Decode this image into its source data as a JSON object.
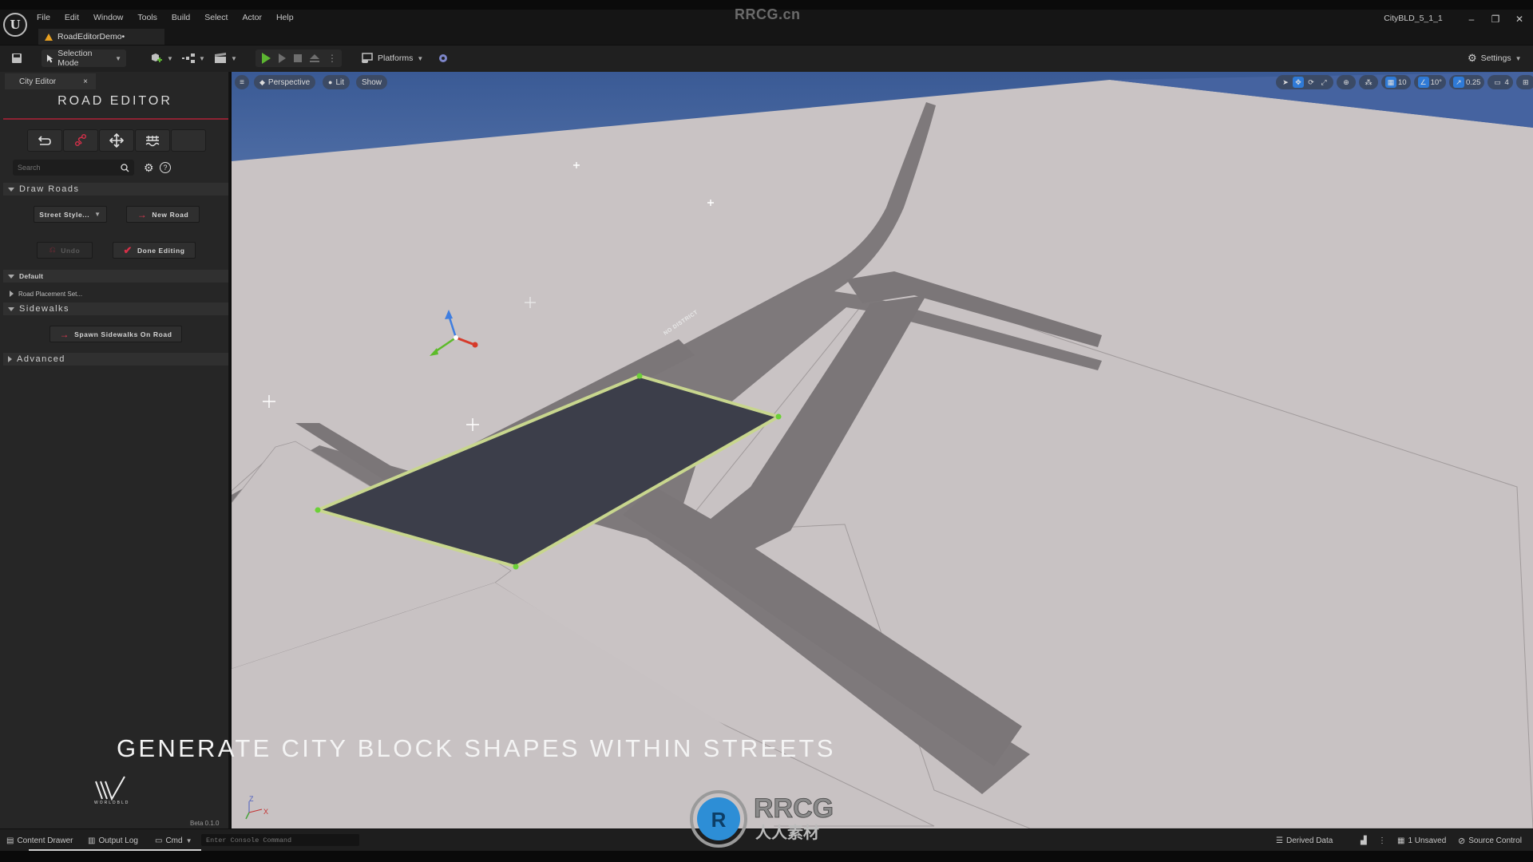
{
  "watermark_top": "RRCG.cn",
  "menu": [
    "File",
    "Edit",
    "Window",
    "Tools",
    "Build",
    "Select",
    "Actor",
    "Help"
  ],
  "document_tab": {
    "label": "RoadEditorDemo•",
    "icon": "warning-icon"
  },
  "project_name": "CityBLD_5_1_1",
  "window_controls": {
    "minimize": "–",
    "restore": "❐",
    "close": "✕"
  },
  "toolbar": {
    "selection_mode": "Selection Mode",
    "platforms": "Platforms",
    "settings": "Settings",
    "icons": [
      "save-icon",
      "add-actor-icon",
      "blueprint-icon",
      "cinematics-icon",
      "play-icon",
      "step-icon",
      "stop-icon",
      "eject-icon",
      "more-icon",
      "platforms-icon",
      "plugin-icon",
      "settings-icon"
    ]
  },
  "left_panel": {
    "tab_label": "City Editor",
    "tab_close": "×",
    "title": "ROAD EDITOR",
    "tools": [
      "undo-icon",
      "road-path-icon",
      "move-icon",
      "bridge-icon",
      ""
    ],
    "search_placeholder": "Search",
    "sections": {
      "draw_roads": {
        "label": "Draw Roads",
        "street_style": "Street Style...",
        "new_road": "New Road",
        "undo": "Undo",
        "done_editing": "Done Editing"
      },
      "default": {
        "label": "Default",
        "sub_item": "Road Placement Set..."
      },
      "sidewalks": {
        "label": "Sidewalks",
        "spawn": "Spawn Sidewalks On Road"
      },
      "advanced": {
        "label": "Advanced"
      }
    }
  },
  "viewport": {
    "view_mode": "Perspective",
    "lighting": "Lit",
    "show": "Show",
    "grid_snap": "10",
    "rotation_snap": "10°",
    "scale_snap": "0.25",
    "camera_speed": "4",
    "block_label": "NO DISTRICT",
    "caption": "GENERATE CITY BLOCK SHAPES WITHIN STREETS",
    "logo_text": "WORLDBLD",
    "version": "Beta 0.1.0",
    "axis_labels": {
      "z": "Z",
      "x": "X"
    },
    "colors": {
      "sky": "#3f5f9a",
      "ground": "#c9c3c4",
      "road": "#7c7779",
      "block": "#3b3c48",
      "outline": "#c6d98a",
      "vertex": "#6bd038"
    }
  },
  "bottom_bar": {
    "content_drawer": "Content Drawer",
    "output_log": "Output Log",
    "cmd": "Cmd",
    "console_placeholder": "Enter Console Command",
    "derived_data": "Derived Data",
    "unsaved": "1 Unsaved",
    "source_control": "Source Control"
  },
  "overlay_logo": {
    "text": "RRCG",
    "subtext": "人人素材"
  }
}
